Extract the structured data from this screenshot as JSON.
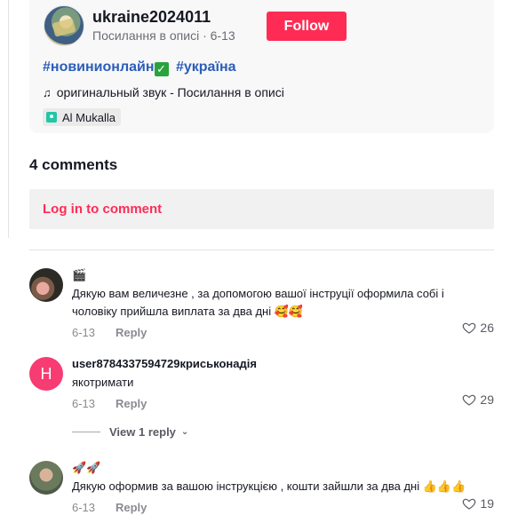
{
  "post": {
    "username": "ukraine2024011",
    "subline": "Посилання в описі · 6-13",
    "follow_label": "Follow",
    "hashtags": [
      "#новинионлайн",
      "#україна"
    ],
    "hashtag_check": "✓",
    "sound": "оригинальный звук - Посилання в описі",
    "location": "Al Mukalla"
  },
  "comments_header": "4 comments",
  "login_prompt": "Log in to comment",
  "comments": [
    {
      "name": "🎬",
      "text_line1": "Дякую вам величезне , за допомогою вашої інструції оформила собі і",
      "text_line2": "чоловіку прийшла виплата за два дні 🥰🥰",
      "date": "6-13",
      "reply_label": "Reply",
      "likes": "26"
    },
    {
      "avatar_letter": "H",
      "name": "user8784337594729криськонадія",
      "text_line1": "якотримати",
      "date": "6-13",
      "reply_label": "Reply",
      "likes": "29"
    },
    {
      "name": "🚀🚀",
      "text_line1": "Дякую оформив за вашою інструкцією , кошти зайшли за два дні 👍👍👍",
      "date": "6-13",
      "reply_label": "Reply",
      "likes": "19"
    }
  ],
  "view_reply_label": "View 1 reply",
  "colors": {
    "accent": "#fe2c55",
    "hashtag": "#2b5db9",
    "avatar_h": "#f63c72"
  }
}
